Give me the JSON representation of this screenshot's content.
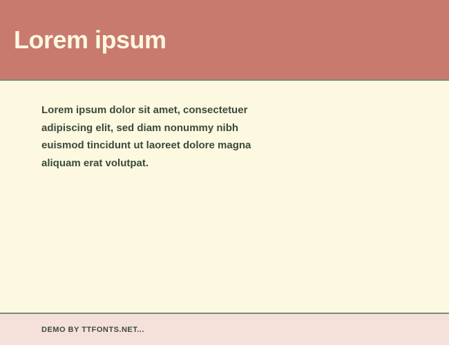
{
  "header": {
    "title": "Lorem ipsum"
  },
  "content": {
    "body_text": "Lorem ipsum dolor sit amet, consectetuer adipiscing elit, sed diam nonummy nibh euismod tincidunt ut laoreet dolore magna aliquam erat volutpat."
  },
  "footer": {
    "text": "DEMO BY TTFONTS.NET..."
  }
}
